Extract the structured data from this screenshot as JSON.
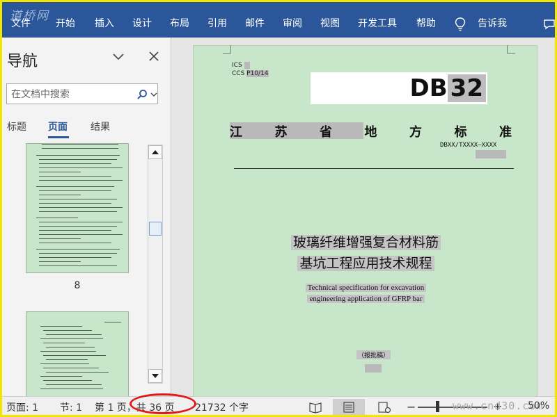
{
  "watermark_top": "道桥网",
  "ribbon": {
    "menu": [
      "文件",
      "开始",
      "插入",
      "设计",
      "布局",
      "引用",
      "邮件",
      "审阅",
      "视图",
      "开发工具",
      "帮助",
      "告诉我"
    ]
  },
  "nav": {
    "title": "导航",
    "search_placeholder": "在文档中搜索",
    "tabs": [
      "标题",
      "页面",
      "结果"
    ],
    "active_tab": "页面",
    "thumb_page_label": "8"
  },
  "document": {
    "ics": "ICS",
    "ccs": "CCS",
    "ccs_code": "P10/14",
    "db_code": "DB32",
    "province_chars": [
      "江",
      "苏",
      "省",
      "地",
      "方",
      "标",
      "准"
    ],
    "std_number": "DBXX/TXXXX—XXXX",
    "title_cn": [
      "玻璃纤维增强复合材料筋",
      "基坑工程应用技术规程"
    ],
    "title_en": [
      "Technical specification for excavation",
      "engineering application of GFRP bar"
    ],
    "draft": "（报批稿）"
  },
  "status": {
    "page": "页面: 1",
    "section": "节: 1",
    "page_of": "第 1 页，共 36 页",
    "words": "21732 个字",
    "zoom": "50%",
    "watermark": "www.cnd30.com"
  },
  "colors": {
    "ribbon": "#2b579a",
    "page_bg": "#c8e6c9",
    "highlight": "#b9b9b9",
    "annotation": "#e01a1a"
  }
}
